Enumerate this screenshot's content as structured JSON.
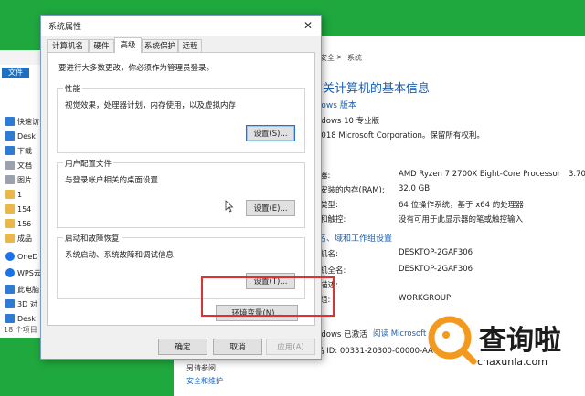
{
  "explorer": {
    "file_tab": "文件",
    "nav": [
      {
        "label": "快速访",
        "icon": "star-icon"
      },
      {
        "label": "Desk",
        "icon": "folder-icon"
      },
      {
        "label": "下载",
        "icon": "download-icon"
      },
      {
        "label": "文档",
        "icon": "document-icon"
      },
      {
        "label": "图片",
        "icon": "picture-icon"
      },
      {
        "label": "1",
        "icon": "folder-icon"
      },
      {
        "label": "154",
        "icon": "folder-icon"
      },
      {
        "label": "156",
        "icon": "folder-icon"
      },
      {
        "label": "成品",
        "icon": "folder-icon"
      },
      {
        "label": "OneD",
        "icon": "cloud-icon"
      },
      {
        "label": "WPS云",
        "icon": "cloud-icon"
      },
      {
        "label": "此电脑",
        "icon": "computer-icon"
      },
      {
        "label": "3D 对",
        "icon": "cube-icon"
      },
      {
        "label": "Desk",
        "icon": "folder-icon"
      }
    ],
    "status": "18 个项目"
  },
  "system_window": {
    "breadcrumb_separator": ">",
    "breadcrumb_page": "系统",
    "breadcrumb_left": "安全",
    "heading": "有关计算机的基本信息",
    "edition_label": "ndows 版本",
    "edition": "ndows 10 专业版",
    "copyright": "2018 Microsoft Corporation。保留所有权利。",
    "specs": [
      {
        "label": "器:",
        "value": "AMD Ryzen 7 2700X Eight-Core Processor",
        "extra": "3.70"
      },
      {
        "label": "安装的内存(RAM):",
        "value": "32.0 GB",
        "extra": ""
      },
      {
        "label": "类型:",
        "value": "64 位操作系统，基于 x64 的处理器",
        "extra": ""
      },
      {
        "label": "和触控:",
        "value": "没有可用于此显示器的笔或触控输入",
        "extra": ""
      }
    ],
    "section_name": "名、域和工作组设置",
    "names": [
      {
        "label": "机名:",
        "value": "DESKTOP-2GAF306"
      },
      {
        "label": "机全名:",
        "value": "DESKTOP-2GAF306"
      },
      {
        "label": "描述:",
        "value": ""
      },
      {
        "label": "组:",
        "value": "WORKGROUP"
      }
    ],
    "activation": "ndows 已激活",
    "activation_link": "阅读 Microsoft",
    "product_id": "品 ID: 00331-20300-00000-AA4",
    "see_also": "另请参阅",
    "security": "安全和维护"
  },
  "dialog": {
    "title": "系统属性",
    "close": "✕",
    "tabs": [
      "计算机名",
      "硬件",
      "高级",
      "系统保护",
      "远程"
    ],
    "active_tab": "高级",
    "intro": "要进行大多数更改，你必须作为管理员登录。",
    "groups": [
      {
        "label": "性能",
        "desc": "视觉效果，处理器计划，内存使用，以及虚拟内存",
        "button": "设置(S)..."
      },
      {
        "label": "用户配置文件",
        "desc": "与登录帐户相关的桌面设置",
        "button": "设置(E)..."
      },
      {
        "label": "启动和故障恢复",
        "desc": "系统启动、系统故障和调试信息",
        "button": "设置(T)..."
      }
    ],
    "env_button": "环境变量(N)...",
    "ok": "确定",
    "cancel": "取消",
    "apply": "应用(A)"
  },
  "watermark": {
    "brand": "查询啦",
    "domain": "chaxunla.com"
  },
  "colors": {
    "accent": "#1a5fb4",
    "highlight": "#e03030",
    "green_bg": "#1fa83e",
    "watermark_orange": "#f39a1e"
  }
}
